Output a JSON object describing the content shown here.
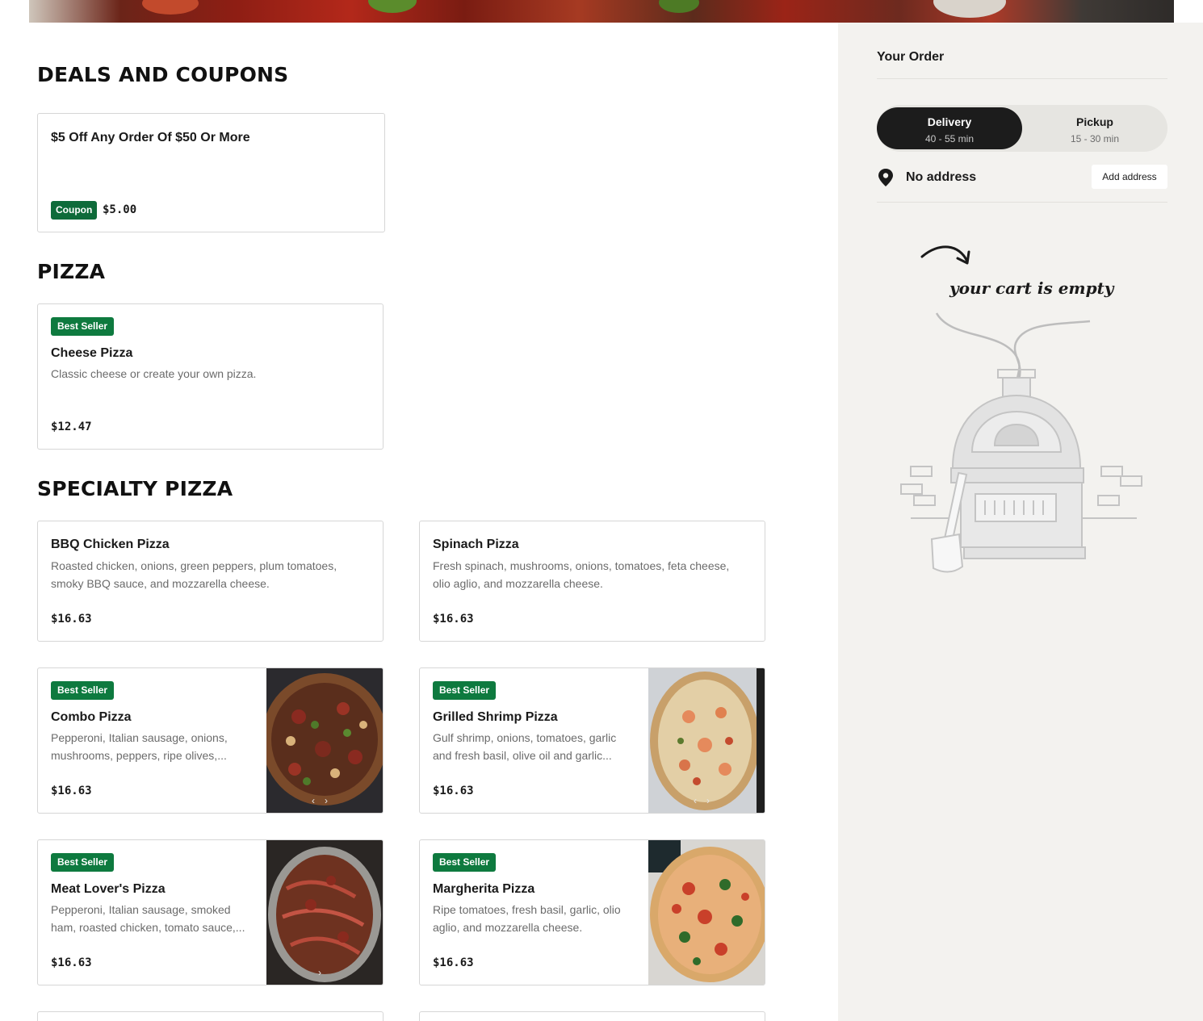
{
  "sections": {
    "deals": {
      "title": "DEALS AND COUPONS",
      "coupon": {
        "name": "$5 Off Any Order Of $50 Or More",
        "tag": "Coupon",
        "value": "$5.00"
      }
    },
    "pizza": {
      "title": "PIZZA",
      "items": [
        {
          "badge": "Best Seller",
          "name": "Cheese Pizza",
          "desc": "Classic cheese or create your own pizza.",
          "price": "$12.47"
        }
      ]
    },
    "specialty": {
      "title": "SPECIALTY PIZZA",
      "items": [
        {
          "name": "BBQ Chicken Pizza",
          "desc": "Roasted chicken, onions, green peppers, plum tomatoes, smoky BBQ sauce, and mozzarella cheese.",
          "price": "$16.63"
        },
        {
          "name": "Spinach Pizza",
          "desc": "Fresh spinach, mushrooms, onions, tomatoes, feta cheese, olio aglio, and mozzarella cheese.",
          "price": "$16.63"
        },
        {
          "badge": "Best Seller",
          "name": "Combo Pizza",
          "desc": "Pepperoni, Italian sausage, onions, mushrooms, peppers, ripe olives,...",
          "price": "$16.63"
        },
        {
          "badge": "Best Seller",
          "name": "Grilled Shrimp Pizza",
          "desc": "Gulf shrimp, onions, tomatoes, garlic and fresh basil, olive oil and garlic...",
          "price": "$16.63"
        },
        {
          "badge": "Best Seller",
          "name": "Meat Lover's Pizza",
          "desc": "Pepperoni, Italian sausage, smoked ham, roasted chicken, tomato sauce,...",
          "price": "$16.63"
        },
        {
          "badge": "Best Seller",
          "name": "Margherita Pizza",
          "desc": "Ripe tomatoes, fresh basil, garlic, olio aglio, and mozzarella cheese.",
          "price": "$16.63"
        }
      ]
    }
  },
  "sidebar": {
    "title": "Your Order",
    "delivery": {
      "label": "Delivery",
      "time": "40 - 55 min"
    },
    "pickup": {
      "label": "Pickup",
      "time": "15 - 30 min"
    },
    "address": {
      "text": "No address",
      "button": "Add address",
      "icon": "location-pin-icon"
    },
    "empty_cart": {
      "text": "your cart is empty",
      "icon": "pizza-oven-illustration"
    }
  },
  "colors": {
    "badge_green": "#0e7a3f",
    "sidebar_bg": "#f3f2ef",
    "toggle_active": "#1c1c1c"
  }
}
